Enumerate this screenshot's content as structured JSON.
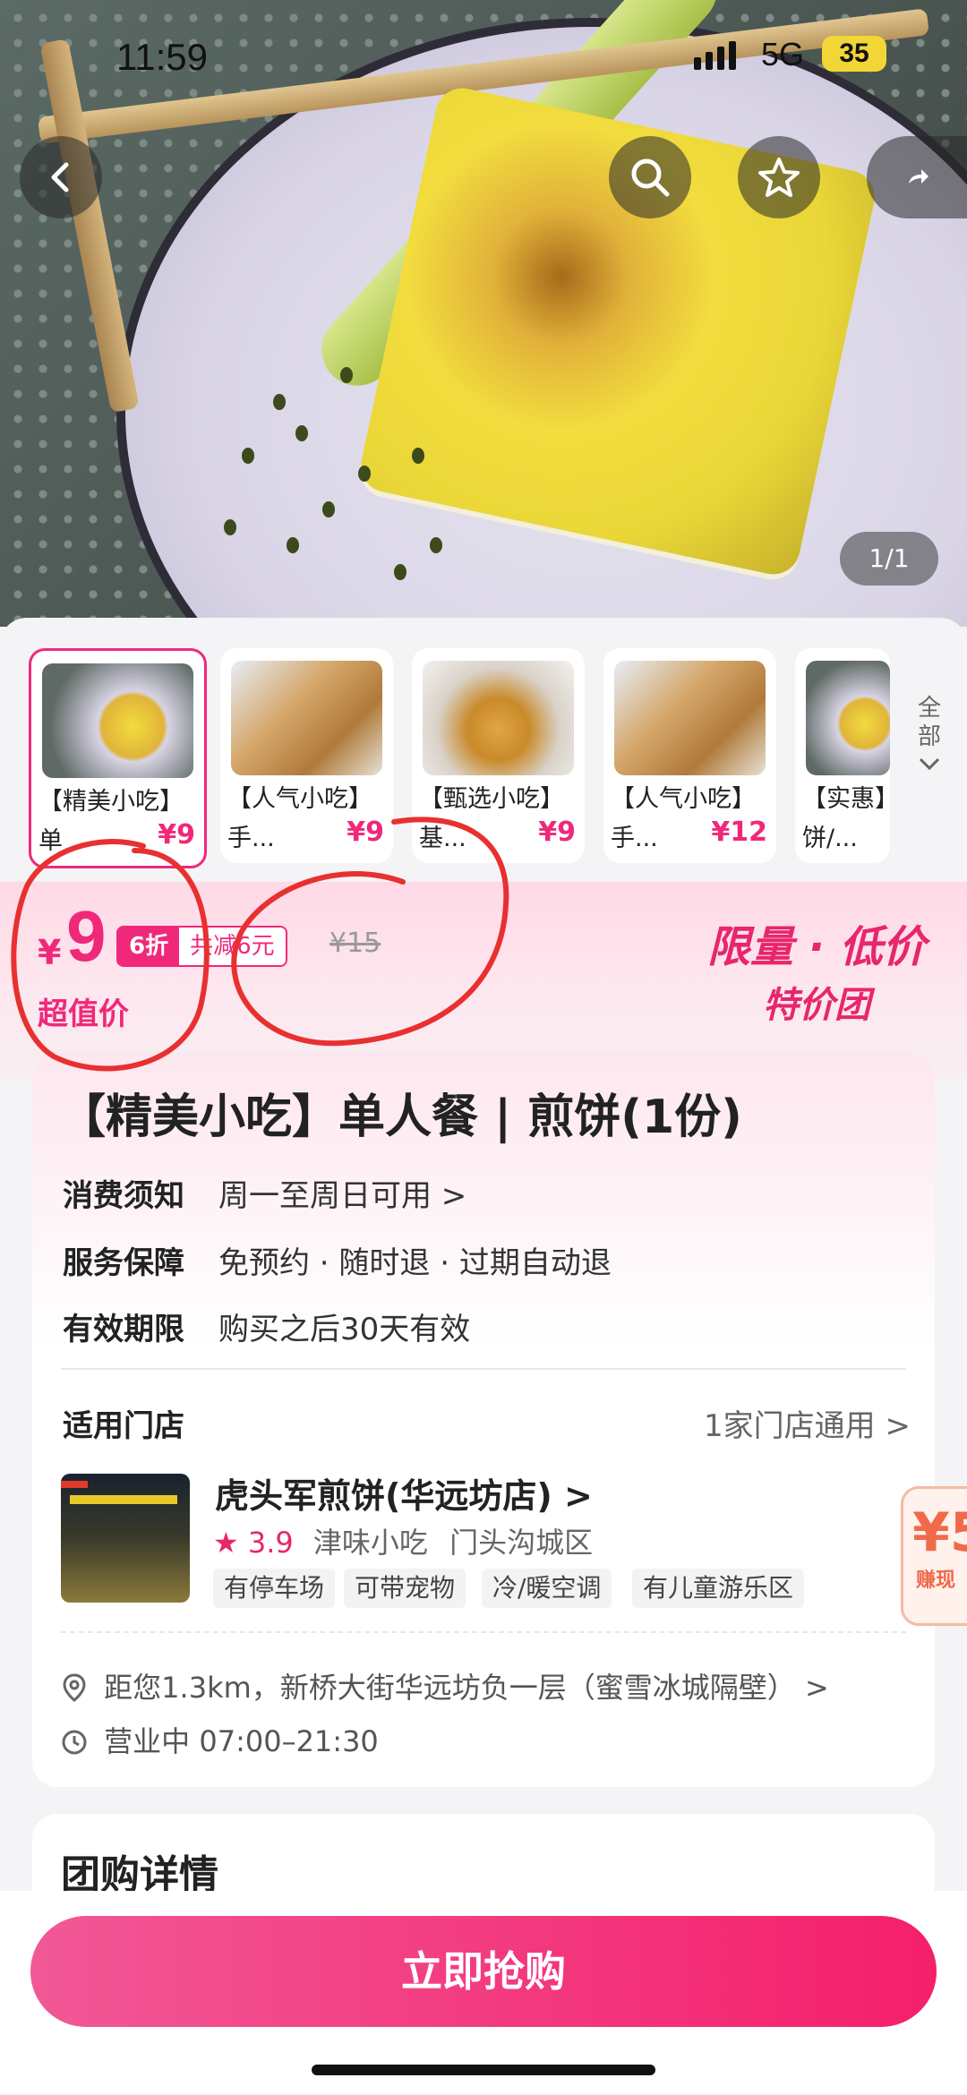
{
  "status_bar": {
    "time": "11:59",
    "network": "5G",
    "battery": "35"
  },
  "hero": {
    "page_indicator": "1/1"
  },
  "thumbnails": [
    {
      "title": "【精美小吃】",
      "subtitle": "单",
      "price": "¥9",
      "selected": true
    },
    {
      "title": "【人气小吃】",
      "subtitle": "手...",
      "price": "¥9",
      "selected": false
    },
    {
      "title": "【甄选小吃】",
      "subtitle": "基...",
      "price": "¥9",
      "selected": false
    },
    {
      "title": "【人气小吃】",
      "subtitle": "手...",
      "price": "¥12",
      "selected": false
    },
    {
      "title": "【实惠】",
      "subtitle": "饼/...",
      "price": "",
      "selected": false
    }
  ],
  "all_button": {
    "line1": "全",
    "line2": "部"
  },
  "price": {
    "currency": "¥",
    "amount": "9",
    "discount_tag": "6折",
    "saving": "共减6元",
    "original": "¥15",
    "value_label": "超值价"
  },
  "promo": {
    "line1": "限量 · 低价",
    "line2": "特价团"
  },
  "product_title": "【精美小吃】单人餐 | 煎饼(1份)",
  "info_rows": [
    {
      "key": "消费须知",
      "value": "周一至周日可用 >"
    },
    {
      "key": "服务保障",
      "value": "免预约 · 随时退 · 过期自动退"
    },
    {
      "key": "有效期限",
      "value": "购买之后30天有效"
    }
  ],
  "store": {
    "section_label": "适用门店",
    "store_count": "1家门店通用 >",
    "name": "虎头军煎饼(华远坊店) >",
    "rating": "3.9",
    "category": "津味小吃",
    "area": "门头沟城区",
    "tags": [
      "有停车场",
      "可带宠物",
      "冷/暖空调",
      "有儿童游乐区"
    ],
    "address": "距您1.3km，新桥大街华远坊负一层（蜜雪冰城隔壁） >",
    "hours": "营业中 07:00–21:30"
  },
  "side_badge": {
    "symbol": "¥5",
    "text": "赚现"
  },
  "group_details_title": "团购详情",
  "buy_button": "立即抢购",
  "colors": {
    "accent": "#f0287a",
    "button_start": "#f25896",
    "button_end": "#f41f6b"
  }
}
